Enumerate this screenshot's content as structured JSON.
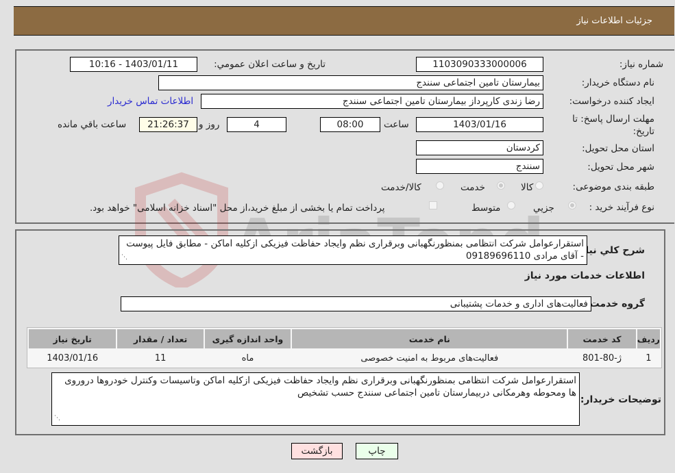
{
  "header": {
    "title": "جزئیات اطلاعات نیاز"
  },
  "form": {
    "need_number": {
      "label": "شماره نیاز:",
      "value": "1103090333000006"
    },
    "announce": {
      "label": "تاریخ و ساعت اعلان عمومي:",
      "value": "1403/01/11 - 10:16"
    },
    "buyer_org": {
      "label": "نام دستگاه خريدار:",
      "value": "بیمارستان تامین اجتماعی سنندج"
    },
    "creator": {
      "label": "ايجاد کننده درخواست:",
      "value": "رضا زندی کارپرداز بیمارستان تامین اجتماعی سنندج",
      "contact_link": "اطلاعات تماس خریدار"
    },
    "deadline": {
      "label": "مهلت ارسال پاسخ: تا تاریخ:",
      "date": "1403/01/16",
      "time_label": "ساعت",
      "time": "08:00",
      "days": "4",
      "days_label": "روز و",
      "remaining": "21:26:37",
      "remaining_label": "ساعت باقي مانده"
    },
    "province": {
      "label": "استان محل تحويل:",
      "value": "کردستان"
    },
    "city": {
      "label": "شهر محل تحويل:",
      "value": "سنندج"
    },
    "category": {
      "label": "طبقه بندی موضوعی:",
      "options": [
        {
          "label": "کالا",
          "selected": false
        },
        {
          "label": "خدمت",
          "selected": true
        },
        {
          "label": "کالا/خدمت",
          "selected": false
        }
      ]
    },
    "purchase_type": {
      "label": "نوع فرآيند خريد :",
      "options": [
        {
          "label": "جزيي",
          "selected": true
        },
        {
          "label": "متوسط",
          "selected": false
        }
      ],
      "treasury_checkbox": {
        "label": "پرداخت تمام یا بخشی از مبلغ خرید،از محل \"اسناد خزانه اسلامی\" خواهد بود.",
        "checked": false
      }
    }
  },
  "details": {
    "general_desc": {
      "label": "شرح کلي نياز:",
      "value": "استقرارعوامل شرکت انتظامی بمنظورنگهبانی وبرقراری نظم وایجاد حفاظت فیزیکی ازکلیه اماکن - مطابق فایل پیوست - آقای مرادی 09189696110"
    },
    "services_title": "اطلاعات خدمات مورد نياز",
    "service_group": {
      "label": "گروه خدمت:",
      "value": "فعالیت‌های اداری و خدمات پشتیبانی"
    },
    "table": {
      "headers": [
        "ردیف",
        "کد خدمت",
        "نام خدمت",
        "واحد اندازه گیری",
        "تعداد / مقدار",
        "تاریخ نیاز"
      ],
      "rows": [
        [
          "1",
          "ژ-80-801",
          "فعالیت‌های مربوط به امنیت خصوصی",
          "ماه",
          "11",
          "1403/01/16"
        ]
      ]
    },
    "buyer_notes": {
      "label": "توضیحات خریدار:",
      "value": "استقرارعوامل شرکت انتظامی بمنظورنگهبانی وبرقراری نظم وایجاد حفاظت فیزیکی ازکلیه اماکن وتاسیسات وکنترل خودروها دروروی ها ومحوطه وهرمکانی دربیمارستان تامین اجتماعی سنندج حسب تشخیص"
    }
  },
  "buttons": {
    "print": "چاپ",
    "back": "بازگشت"
  },
  "watermark": {
    "text": "AriaTender.neT"
  },
  "colors": {
    "header_bg": "#8c6b42",
    "print_bg": "#eaffea",
    "back_bg": "#ffe0e0",
    "link": "#2a2ad0"
  }
}
